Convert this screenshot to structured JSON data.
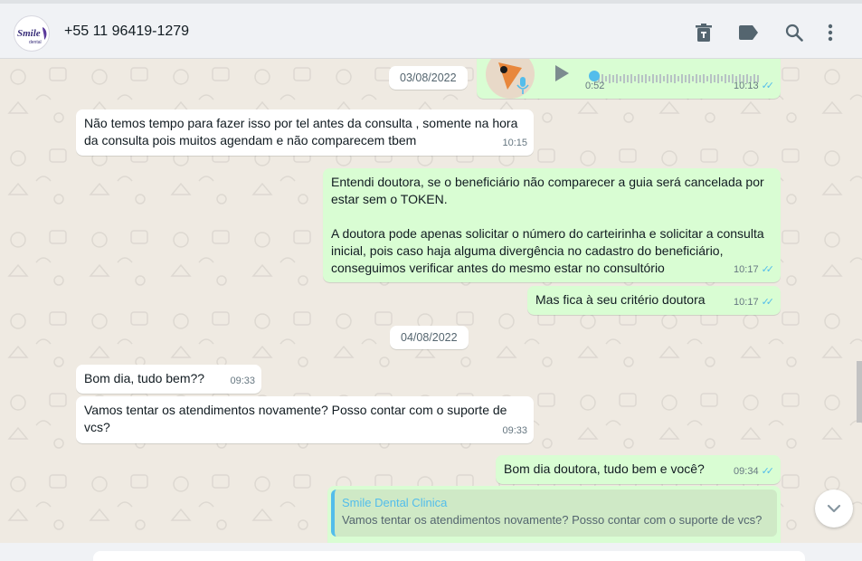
{
  "header": {
    "contact": "+55 11 96419-1279",
    "avatar_text": "Smile",
    "avatar_subtext": "dental",
    "icons": [
      "delete-icon",
      "label-icon",
      "search-icon",
      "menu-icon"
    ]
  },
  "audio": {
    "duration": "0:52",
    "time": "10:13"
  },
  "dates": {
    "first": "03/08/2022",
    "second": "04/08/2022"
  },
  "messages": [
    {
      "text": "Não temos tempo para fazer isso por tel antes da consulta , somente na hora\nda consulta pois muitos agendam e não comparecem tbem",
      "time": "10:15"
    },
    {
      "text": "Entendi doutora, se o beneficiário não comparecer a guia será cancelada por\nestar sem o TOKEN.\n\nA doutora pode apenas solicitar o número do carteirinha e solicitar a consulta\ninicial, pois caso haja alguma divergência no cadastro do beneficiário,\nconseguimos verificar antes do mesmo estar no consultório",
      "time": "10:17"
    },
    {
      "text": "Mas fica à seu critério doutora",
      "time": "10:17"
    },
    {
      "text": "Bom dia, tudo bem??",
      "time": "09:33"
    },
    {
      "text": "Vamos tentar os atendimentos novamente? Posso contar com o suporte de\nvcs?",
      "time": "09:33"
    },
    {
      "text": "Bom dia doutora, tudo bem e você?",
      "time": "09:34"
    }
  ],
  "quote": {
    "author": "Smile Dental Clinica",
    "text": "Vamos tentar os atendimentos novamente? Posso contar com o suporte de vcs?"
  },
  "colors": {
    "incoming": "#ffffff",
    "outgoing": "#d9fdd3",
    "read_ticks": "#53bdeb",
    "quote_accent": "#53bdeb",
    "audio_accent": "#53bdeb"
  }
}
